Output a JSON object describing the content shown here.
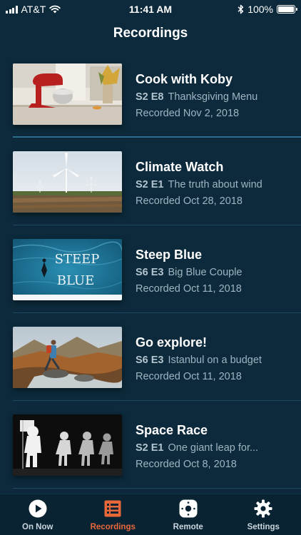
{
  "status_bar": {
    "carrier": "AT&T",
    "time": "11:41 AM",
    "battery": "100%"
  },
  "nav": {
    "title": "Recordings"
  },
  "recordings": [
    {
      "title": "Cook with Koby",
      "episode": "S2 E8",
      "episode_title": "Thanksgiving Menu",
      "recorded": "Recorded Nov 2, 2018",
      "thumbnail_icon": "stand-mixer-image"
    },
    {
      "title": "Climate Watch",
      "episode": "S2 E1",
      "episode_title": "The truth about wind",
      "recorded": "Recorded Oct 28, 2018",
      "thumbnail_icon": "wind-turbines-image"
    },
    {
      "title": "Steep Blue",
      "episode": "S6 E3",
      "episode_title": "Big Blue Couple",
      "recorded": "Recorded Oct 11, 2018",
      "thumbnail_icon": "ocean-diver-image",
      "thumbnail_text_1": "STEEP",
      "thumbnail_text_2": "BLUE"
    },
    {
      "title": "Go explore!",
      "episode": "S6 E3",
      "episode_title": "Istanbul on a budget",
      "recorded": "Recorded Oct 11, 2018",
      "thumbnail_icon": "hiker-image"
    },
    {
      "title": "Space Race",
      "episode": "S2 E1",
      "episode_title": "One giant leap for...",
      "recorded": "Recorded Oct 8, 2018",
      "thumbnail_icon": "astronaut-figures-image"
    }
  ],
  "tabs": [
    {
      "label": "On Now",
      "icon": "play-icon",
      "active": false
    },
    {
      "label": "Recordings",
      "icon": "recordings-list-icon",
      "active": true
    },
    {
      "label": "Remote",
      "icon": "remote-icon",
      "active": false
    },
    {
      "label": "Settings",
      "icon": "gear-icon",
      "active": false
    }
  ],
  "colors": {
    "background": "#0c2a3b",
    "accent": "#e8683a",
    "secondary_text": "#9fb4c2"
  }
}
